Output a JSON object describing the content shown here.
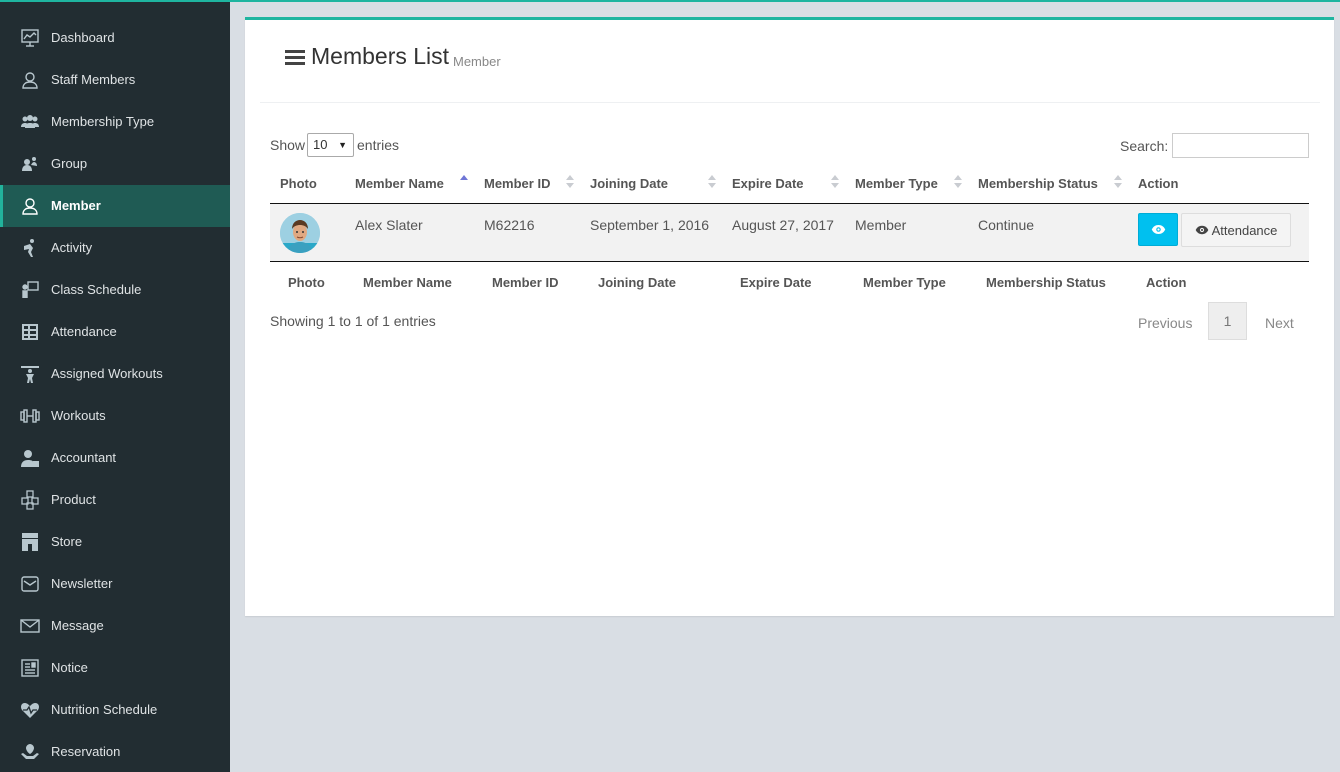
{
  "sidebar": {
    "items": [
      {
        "label": "Dashboard",
        "icon": "dashboard-icon",
        "active": false
      },
      {
        "label": "Staff Members",
        "icon": "staff-icon",
        "active": false
      },
      {
        "label": "Membership Type",
        "icon": "membership-type-icon",
        "active": false
      },
      {
        "label": "Group",
        "icon": "group-icon",
        "active": false
      },
      {
        "label": "Member",
        "icon": "member-icon",
        "active": true
      },
      {
        "label": "Activity",
        "icon": "activity-icon",
        "active": false
      },
      {
        "label": "Class Schedule",
        "icon": "class-schedule-icon",
        "active": false
      },
      {
        "label": "Attendance",
        "icon": "attendance-icon",
        "active": false
      },
      {
        "label": "Assigned Workouts",
        "icon": "assigned-workouts-icon",
        "active": false
      },
      {
        "label": "Workouts",
        "icon": "workouts-icon",
        "active": false
      },
      {
        "label": "Accountant",
        "icon": "accountant-icon",
        "active": false
      },
      {
        "label": "Product",
        "icon": "product-icon",
        "active": false
      },
      {
        "label": "Store",
        "icon": "store-icon",
        "active": false
      },
      {
        "label": "Newsletter",
        "icon": "newsletter-icon",
        "active": false
      },
      {
        "label": "Message",
        "icon": "message-icon",
        "active": false
      },
      {
        "label": "Notice",
        "icon": "notice-icon",
        "active": false
      },
      {
        "label": "Nutrition Schedule",
        "icon": "nutrition-schedule-icon",
        "active": false
      },
      {
        "label": "Reservation",
        "icon": "reservation-icon",
        "active": false
      }
    ]
  },
  "header": {
    "title": "Members List",
    "subtitle": "Member"
  },
  "controls": {
    "show_label": "Show",
    "entries_value": "10",
    "entries_label": "entries",
    "search_label": "Search:",
    "search_value": ""
  },
  "table": {
    "columns": [
      "Photo",
      "Member Name",
      "Member ID",
      "Joining Date",
      "Expire Date",
      "Member Type",
      "Membership Status",
      "Action"
    ],
    "sorted_column": "Member Name",
    "rows": [
      {
        "member_name": "Alex Slater",
        "member_id": "M62216",
        "joining_date": "September 1, 2016",
        "expire_date": "August 27, 2017",
        "member_type": "Member",
        "membership_status": "Continue",
        "attendance_label": "Attendance"
      }
    ]
  },
  "footer": {
    "info": "Showing 1 to 1 of 1 entries",
    "previous": "Previous",
    "current_page": "1",
    "next": "Next"
  },
  "colors": {
    "accent": "#1fb5a0",
    "sidebar_bg": "#222d32",
    "active_bg": "#1f5b54",
    "view_button": "#00c0ef"
  }
}
